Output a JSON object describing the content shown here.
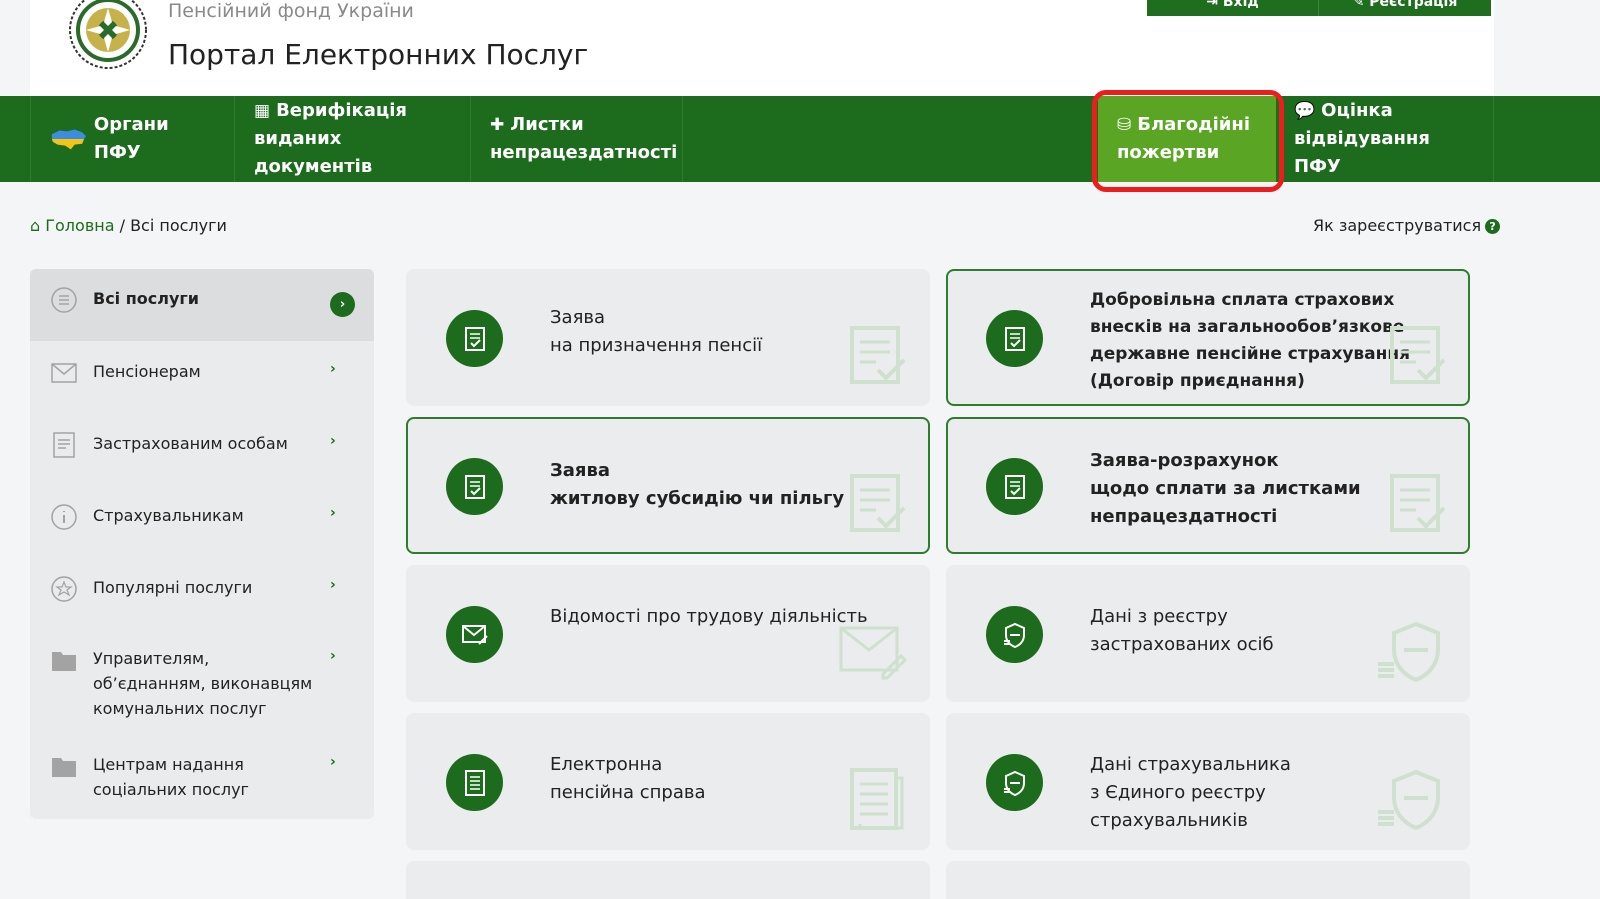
{
  "header": {
    "org_name": "Пенсійний фонд України",
    "portal_title": "Портал Електронних Послуг",
    "login": "⇥ Вхід",
    "register": "✎ Реєстрація"
  },
  "nav": {
    "organs": "Органи ПФУ",
    "verification": "Верифікація виданих документів",
    "sick_leave": "Листки непрацездатності",
    "charity": "Благодійні пожертви",
    "rating": "Оцінка відвідування ПФУ"
  },
  "breadcrumb": {
    "home": "Головна",
    "separator": " / ",
    "current": "Всі послуги"
  },
  "register_help": "Як зареєструватися",
  "sidebar": {
    "items": [
      {
        "label": "Всі послуги",
        "icon": "list-icon"
      },
      {
        "label": "Пенсіонерам",
        "icon": "envelope-icon"
      },
      {
        "label": "Застрахованим особам",
        "icon": "document-icon"
      },
      {
        "label": "Страхувальникам",
        "icon": "info-icon"
      },
      {
        "label": "Популярні послуги",
        "icon": "star-icon"
      },
      {
        "label": "Управителям, об’єднанням, виконавцям комунальних послуг",
        "icon": "folder-icon"
      },
      {
        "label": "Центрам надання соціальних послуг",
        "icon": "folder-icon"
      }
    ]
  },
  "cards": [
    {
      "title": "Заява",
      "subtitle": "на призначення пенсії",
      "icon": "document-check-icon"
    },
    {
      "title": "Добровільна сплата страхових внесків на загальнообов’язкове державне пенсійне страхування (Договір приєднання)",
      "subtitle": "",
      "icon": "document-check-icon"
    },
    {
      "title": "Заява",
      "subtitle": "житлову субсидію чи пільгу",
      "icon": "document-check-icon"
    },
    {
      "title": "Заява-розрахунок",
      "subtitle": "щодо сплати за листками непрацездатності",
      "icon": "document-check-icon"
    },
    {
      "title": "Відомості про трудову діяльність",
      "subtitle": "",
      "icon": "envelope-pen-icon"
    },
    {
      "title": "Дані з реєстру",
      "subtitle": "застрахованих осіб",
      "icon": "shield-coins-icon"
    },
    {
      "title": "Електронна",
      "subtitle": "пенсійна справа",
      "icon": "file-folder-icon"
    },
    {
      "title": "Дані страхувальника",
      "subtitle": "з Єдиного реєстру страхувальників",
      "icon": "shield-coins-icon"
    }
  ],
  "colors": {
    "brand_green": "#1d6b1d",
    "charity_green": "#5aa524",
    "highlight_red": "#ee1c1c"
  }
}
